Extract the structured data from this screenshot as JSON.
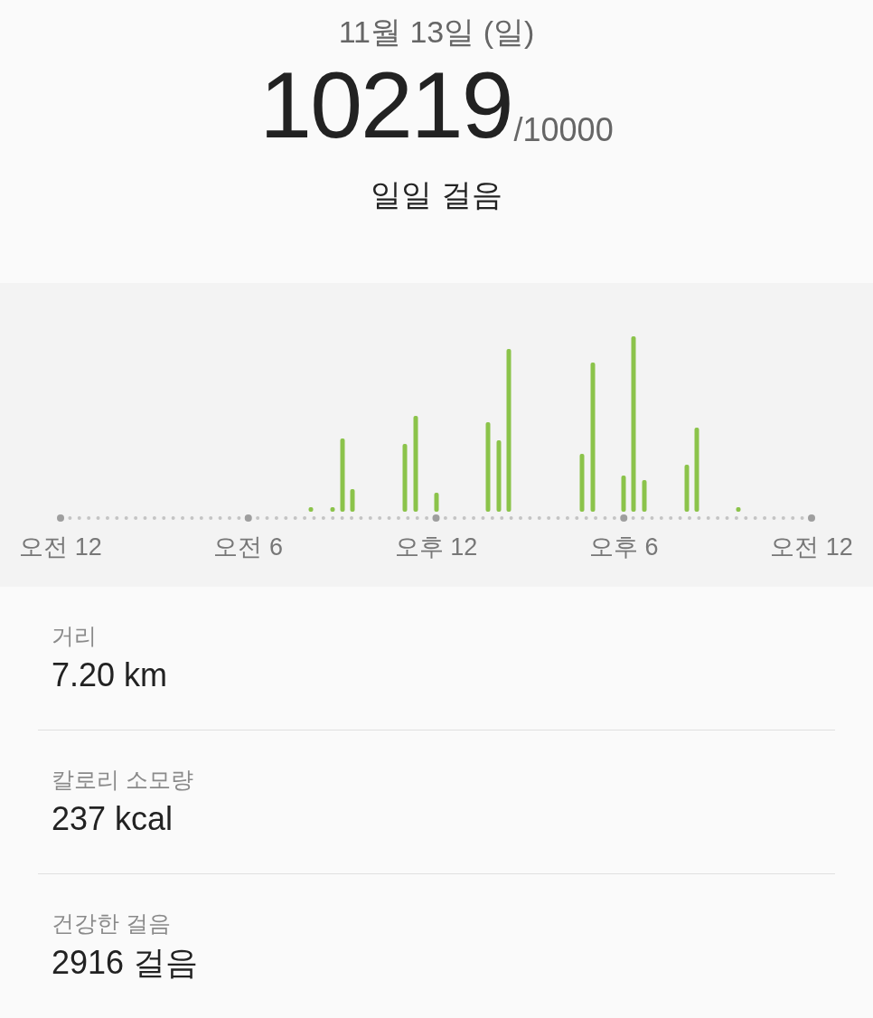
{
  "header": {
    "date": "11월 13일 (일)",
    "steps": "10219",
    "goal": "/10000",
    "title": "일일 걸음"
  },
  "chart": {
    "x_labels": [
      "오전 12",
      "오전 6",
      "오후 12",
      "오후 6",
      "오전 12"
    ]
  },
  "stats": [
    {
      "label": "거리",
      "value": "7.20 km"
    },
    {
      "label": "칼로리 소모량",
      "value": "237 kcal"
    },
    {
      "label": "건강한 걸음",
      "value": "2916 걸음"
    }
  ]
}
